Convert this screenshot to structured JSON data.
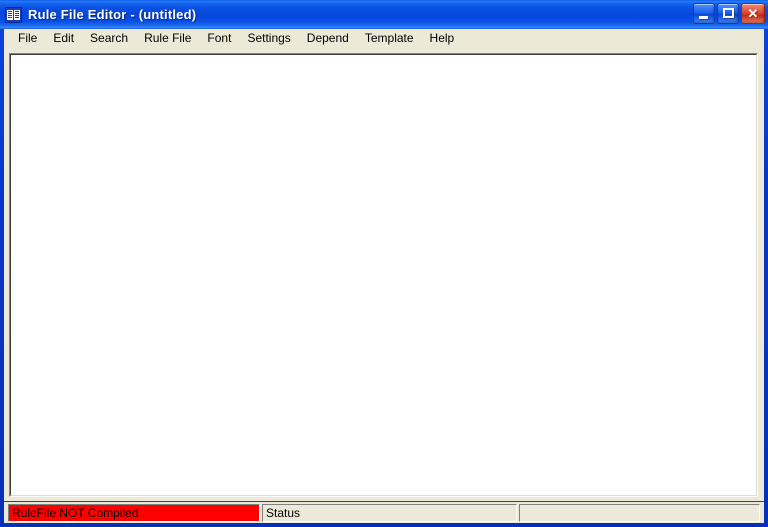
{
  "window": {
    "title": "Rule File Editor  -  (untitled)",
    "icon": "book-pages-icon",
    "controls": {
      "minimize_label": "_",
      "maximize_label": "□",
      "close_label": "✕"
    }
  },
  "menubar": {
    "items": [
      {
        "label": "File"
      },
      {
        "label": "Edit"
      },
      {
        "label": "Search"
      },
      {
        "label": "Rule File"
      },
      {
        "label": "Font"
      },
      {
        "label": "Settings"
      },
      {
        "label": "Depend"
      },
      {
        "label": "Template"
      },
      {
        "label": "Help"
      }
    ]
  },
  "editor": {
    "content": "",
    "placeholder": ""
  },
  "statusbar": {
    "panels": [
      {
        "name": "compile-state",
        "text": "RuleFile  NOT Compiled",
        "color": "#ff0000"
      },
      {
        "name": "status",
        "text": "Status",
        "color": "#ece9d8"
      },
      {
        "name": "extra",
        "text": "",
        "color": "#ece9d8"
      }
    ]
  },
  "colors": {
    "title_blue": "#0646dc",
    "menu_bg": "#ece9d8",
    "frame_blue": "#0836c6",
    "alert_red": "#ff0000",
    "editor_bg": "#ffffff"
  }
}
